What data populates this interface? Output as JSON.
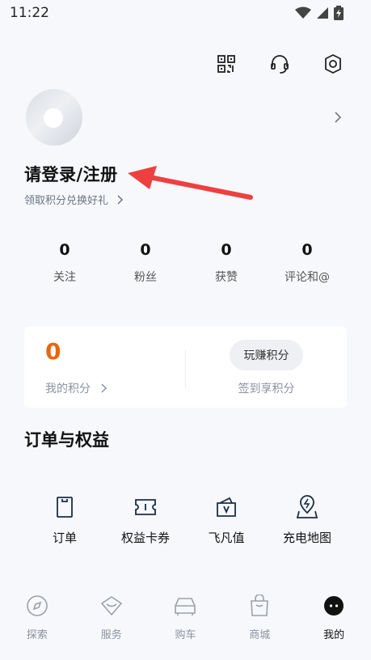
{
  "status_bar": {
    "time": "11:22"
  },
  "profile": {
    "login_label": "请登录/注册",
    "promo_text": "领取积分兑换好礼"
  },
  "stats": [
    {
      "value": "0",
      "label": "关注"
    },
    {
      "value": "0",
      "label": "粉丝"
    },
    {
      "value": "0",
      "label": "获赞"
    },
    {
      "value": "0",
      "label": "评论和@"
    }
  ],
  "points": {
    "value": "0",
    "label": "我的积分",
    "earn_button": "玩赚积分",
    "earn_subtitle": "签到享积分",
    "accent_color": "#e9650d"
  },
  "orders_section": {
    "title": "订单与权益",
    "items": [
      {
        "label": "订单",
        "icon": "order-icon"
      },
      {
        "label": "权益卡券",
        "icon": "coupon-icon"
      },
      {
        "label": "飞凡值",
        "icon": "wallet-icon"
      },
      {
        "label": "充电地图",
        "icon": "charging-map-icon"
      }
    ]
  },
  "tabbar": [
    {
      "label": "探索",
      "icon": "compass-icon"
    },
    {
      "label": "服务",
      "icon": "service-icon"
    },
    {
      "label": "购车",
      "icon": "car-icon"
    },
    {
      "label": "商城",
      "icon": "shopping-bag-icon"
    },
    {
      "label": "我的",
      "icon": "profile-face-icon",
      "active": true
    }
  ]
}
